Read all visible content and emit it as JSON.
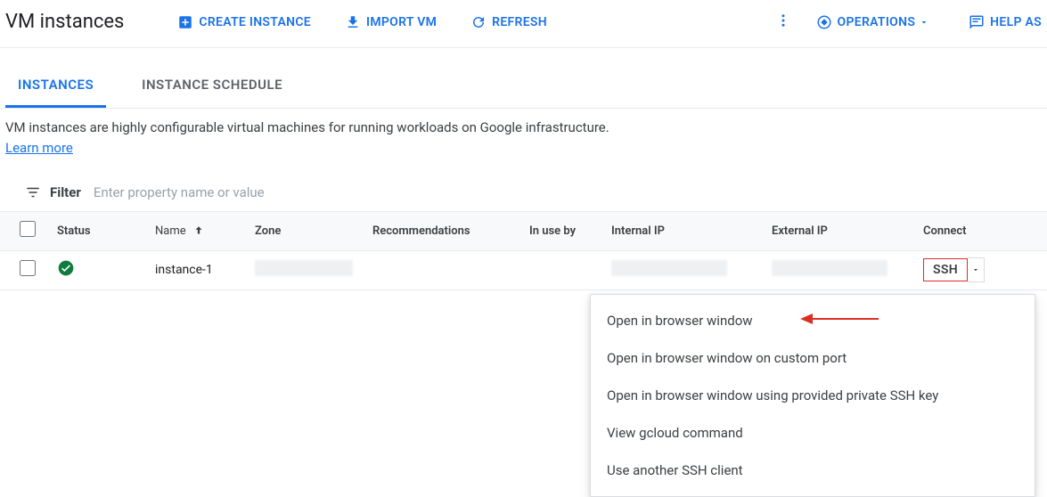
{
  "toolbar": {
    "page_title": "VM instances",
    "create": "CREATE INSTANCE",
    "import": "IMPORT VM",
    "refresh": "REFRESH",
    "operations": "OPERATIONS",
    "help": "HELP AS"
  },
  "tabs": {
    "instances": "INSTANCES",
    "schedule": "INSTANCE SCHEDULE"
  },
  "description": {
    "text": "VM instances are highly configurable virtual machines for running workloads on Google infrastructure. ",
    "learn_more": "Learn more"
  },
  "filter": {
    "label": "Filter",
    "placeholder": "Enter property name or value"
  },
  "columns": {
    "status": "Status",
    "name": "Name",
    "zone": "Zone",
    "recommendations": "Recommendations",
    "in_use_by": "In use by",
    "internal_ip": "Internal IP",
    "external_ip": "External IP",
    "connect": "Connect"
  },
  "rows": [
    {
      "name": "instance-1",
      "ssh": "SSH"
    }
  ],
  "menu": {
    "items": [
      "Open in browser window",
      "Open in browser window on custom port",
      "Open in browser window using provided private SSH key",
      "View gcloud command",
      "Use another SSH client"
    ]
  }
}
